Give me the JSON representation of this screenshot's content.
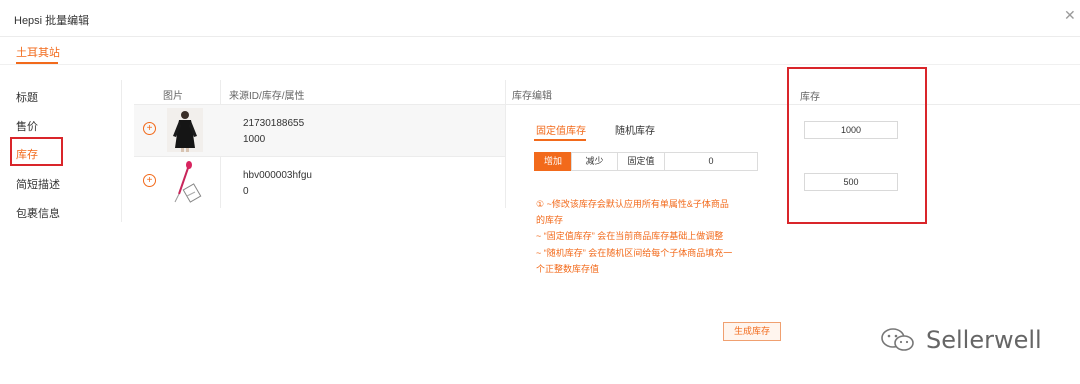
{
  "dialog": {
    "title": "Hepsi 批量编辑",
    "close_icon": "close-icon"
  },
  "site_tab": "土耳其站",
  "nav": [
    "标题",
    "售价",
    "库存",
    "简短描述",
    "包裹信息"
  ],
  "table": {
    "headers": {
      "image": "图片",
      "source": "来源ID/库存/属性",
      "edit": "库存编辑",
      "stock": "库存"
    },
    "rows": [
      {
        "source_id": "21730188655",
        "stock": "1000",
        "stock_value": "1000"
      },
      {
        "source_id": "hbv000003hfgu",
        "stock": "0",
        "stock_value": "500"
      }
    ]
  },
  "editor": {
    "tabs": [
      "固定值库存",
      "随机库存"
    ],
    "segments": [
      "增加",
      "减少",
      "固定值"
    ],
    "value": "0",
    "notes": [
      "① ~修改该库存会默认应用所有单属性&子体商品",
      "的库存",
      "~ “固定值库存” 会在当前商品库存基础上做调整",
      "~ “随机库存” 会在随机区间给每个子体商品填充一",
      "个正整数库存值"
    ],
    "generate_button": "生成库存"
  },
  "watermark": {
    "text": "Sellerwell",
    "icon": "wechat-icon"
  },
  "colors": {
    "accent": "#f26a1b",
    "highlight": "#d9252a"
  }
}
